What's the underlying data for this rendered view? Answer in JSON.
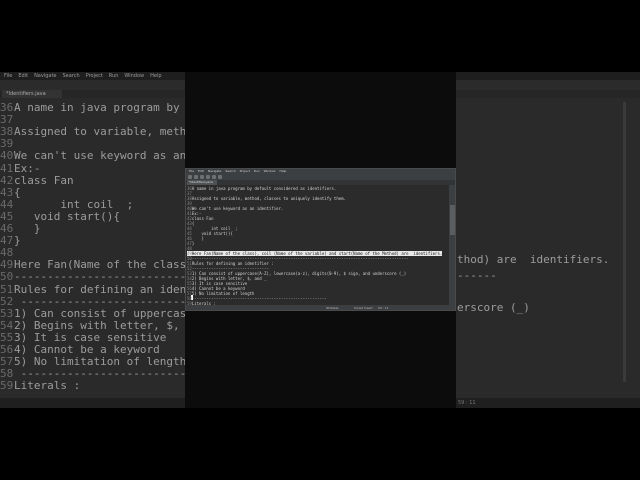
{
  "menu": [
    "File",
    "Edit",
    "Navigate",
    "Search",
    "Project",
    "Run",
    "Window",
    "Help"
  ],
  "tab_label": "*Identifiers.java",
  "code_lines": [
    {
      "n": "36",
      "t": "A name in java program by default considered as identifiers."
    },
    {
      "n": "37",
      "t": ""
    },
    {
      "n": "38",
      "t": "Assigned to variable, method, classes to uniquely identify them."
    },
    {
      "n": "39",
      "t": ""
    },
    {
      "n": "40",
      "t": "We can't use keyword as an identifier."
    },
    {
      "n": "41",
      "t": "Ex:-"
    },
    {
      "n": "42",
      "t": "class Fan"
    },
    {
      "n": "43",
      "t": "{"
    },
    {
      "n": "44",
      "t": "        int coil  ;"
    },
    {
      "n": "45",
      "t": "    void start(){"
    },
    {
      "n": "46",
      "t": "    }"
    },
    {
      "n": "47",
      "t": "}"
    },
    {
      "n": "48",
      "t": ""
    },
    {
      "n": "49",
      "t": "Here Fan(Name of the class), coil (Name of the variable) and start(Name of the Method) are  identifiers."
    },
    {
      "n": "50",
      "t": "------------------------------------------------------------------------------------------"
    },
    {
      "n": "51",
      "t": "Rules for defining an identifier :"
    },
    {
      "n": "52",
      "t": "--------------------------------"
    },
    {
      "n": "53",
      "t": "1) Can consist of uppercase(A-Z), lowercase(a-z), digits(0-9), $ sign, and underscore (_)"
    },
    {
      "n": "54",
      "t": "2) Begins with letter, $, and _"
    },
    {
      "n": "55",
      "t": "3) It is case sensitive"
    },
    {
      "n": "56",
      "t": "4) Cannot be a keyword"
    },
    {
      "n": "57",
      "t": "5) No limitation of length"
    },
    {
      "n": "58",
      "t": "--------------------------------------------------------"
    },
    {
      "n": "59",
      "t": "Literals :"
    }
  ],
  "bg_lines": [
    {
      "n": "36",
      "t": "A name in java program by defa"
    },
    {
      "n": "37",
      "t": ""
    },
    {
      "n": "38",
      "t": "Assigned to variable, method, "
    },
    {
      "n": "39",
      "t": ""
    },
    {
      "n": "40",
      "t": "We can't use keyword as an ide"
    },
    {
      "n": "41",
      "t": "Ex:-"
    },
    {
      "n": "42",
      "t": "class Fan"
    },
    {
      "n": "43",
      "t": "{"
    },
    {
      "n": "44",
      "t": "       int coil  ;"
    },
    {
      "n": "45",
      "t": "   void start(){"
    },
    {
      "n": "46",
      "t": "   }"
    },
    {
      "n": "47",
      "t": "}"
    },
    {
      "n": "48",
      "t": ""
    },
    {
      "n": "49",
      "t": "Here Fan(Name of the class), "
    },
    {
      "n": "50",
      "t": "------------------------------"
    },
    {
      "n": "51",
      "t": "Rules for defining an identifi"
    },
    {
      "n": "52",
      "t": " ------------------------------"
    },
    {
      "n": "53",
      "t": "1) Can consist of uppercase(A-"
    },
    {
      "n": "54",
      "t": "2) Begins with letter, $, and "
    },
    {
      "n": "55",
      "t": "3) It is case sensitive"
    },
    {
      "n": "56",
      "t": "4) Cannot be a keyword"
    },
    {
      "n": "57",
      "t": "5) No limitation of length"
    },
    {
      "n": "58",
      "t": " ------------------------------"
    },
    {
      "n": "59",
      "t": "Literals :"
    }
  ],
  "bg_right": {
    "line49": "thod) are  identifiers.",
    "line50": "------",
    "line53": "erscore (_)"
  },
  "status": {
    "writable": "Writable",
    "insert": "Smart Insert",
    "position": "59 : 11"
  }
}
